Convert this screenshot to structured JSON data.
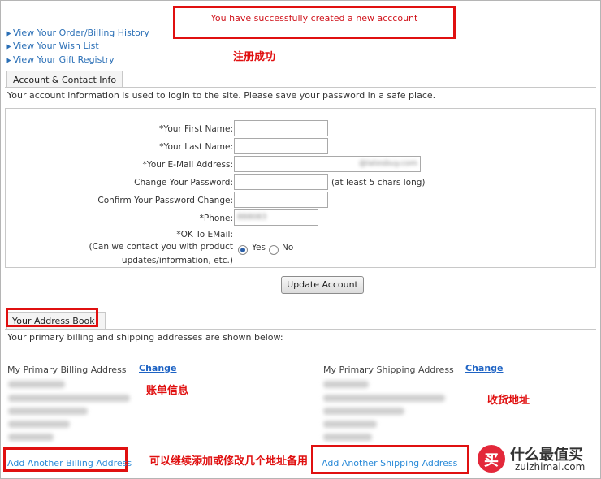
{
  "success_message": "You have successfully created a new acccount",
  "annotations": {
    "register_success": "注册成功",
    "billing_info": "账单信息",
    "shipping_address": "收货地址",
    "add_or_modify": "可以继续添加或修改几个地址备用"
  },
  "quick_links": [
    {
      "label": "View Your Order/Billing History"
    },
    {
      "label": "View Your Wish List"
    },
    {
      "label": "View Your Gift Registry"
    }
  ],
  "account_section": {
    "tab": "Account & Contact Info",
    "description": "Your account information is used to login to the site. Please save your password in a safe place.",
    "fields": {
      "first_name_label": "*Your First Name:",
      "last_name_label": "*Your Last Name:",
      "email_label": "*Your E-Mail Address:",
      "email_value": "@latesbuy.com",
      "change_password_label": "Change Your Password:",
      "password_hint": "(at least 5 chars long)",
      "confirm_password_label": "Confirm Your Password Change:",
      "phone_label": "*Phone:",
      "phone_value": "888083",
      "ok_email_label": "*OK To EMail:",
      "contact_question_1": "(Can we contact you with product",
      "contact_question_2": "updates/information, etc.)",
      "yes_label": "Yes",
      "no_label": "No",
      "ok_email_selected": "Yes"
    },
    "update_button": "Update Account"
  },
  "address_section": {
    "tab": "Your Address Book",
    "description": "Your primary billing and shipping addresses are shown below:",
    "billing_label": "My Primary Billing Address",
    "shipping_label": "My Primary Shipping Address",
    "change_label": "Change",
    "add_billing": "Add Another Billing Address",
    "add_shipping": "Add Another Shipping Address"
  },
  "watermark": {
    "icon_char": "买",
    "cn": "什么最值买",
    "en": "zuizhimai.com"
  }
}
